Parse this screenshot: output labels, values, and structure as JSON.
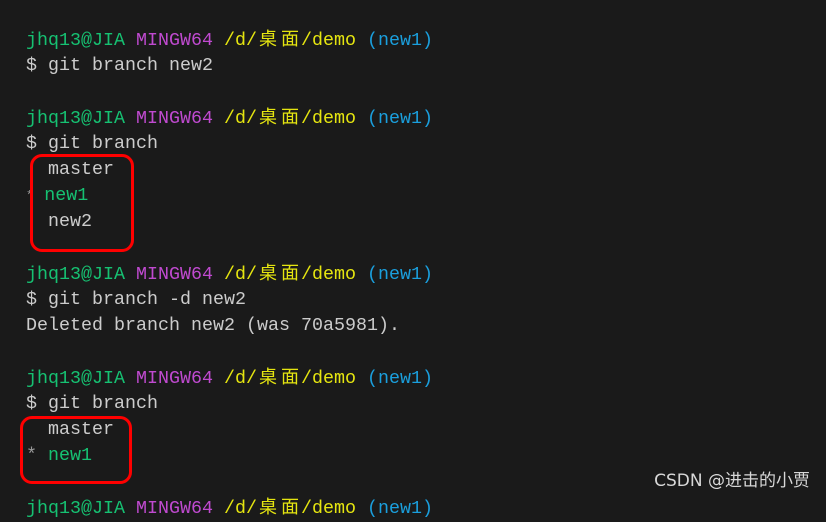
{
  "prompt": {
    "user": "jhq13@JIA",
    "system": "MINGW64",
    "path_prefix": "/d/",
    "path_cjk_1": "桌",
    "path_cjk_2": "面",
    "path_suffix": "/demo",
    "branch": "(new1)"
  },
  "colors": {
    "user": "#16c172",
    "system": "#c04ad0",
    "path": "#e5e510",
    "branch": "#1a9fdd",
    "highlight_box": "#ff0000",
    "background": "#1a1a1a"
  },
  "blocks": [
    {
      "command": "$ git branch new2",
      "output": []
    },
    {
      "command": "$ git branch",
      "branches": [
        {
          "marker": " ",
          "name": "master",
          "current": false
        },
        {
          "marker": "*",
          "name": "new1",
          "current": true
        },
        {
          "marker": " ",
          "name": "new2",
          "current": false
        }
      ]
    },
    {
      "command": "$ git branch -d new2",
      "output_text": "Deleted branch new2 (was 70a5981)."
    },
    {
      "command": "$ git branch",
      "branches": [
        {
          "marker": " ",
          "name": "master",
          "current": false
        },
        {
          "marker": "*",
          "name": "new1",
          "current": true
        }
      ]
    }
  ],
  "watermark": "CSDN @进击的小贾"
}
